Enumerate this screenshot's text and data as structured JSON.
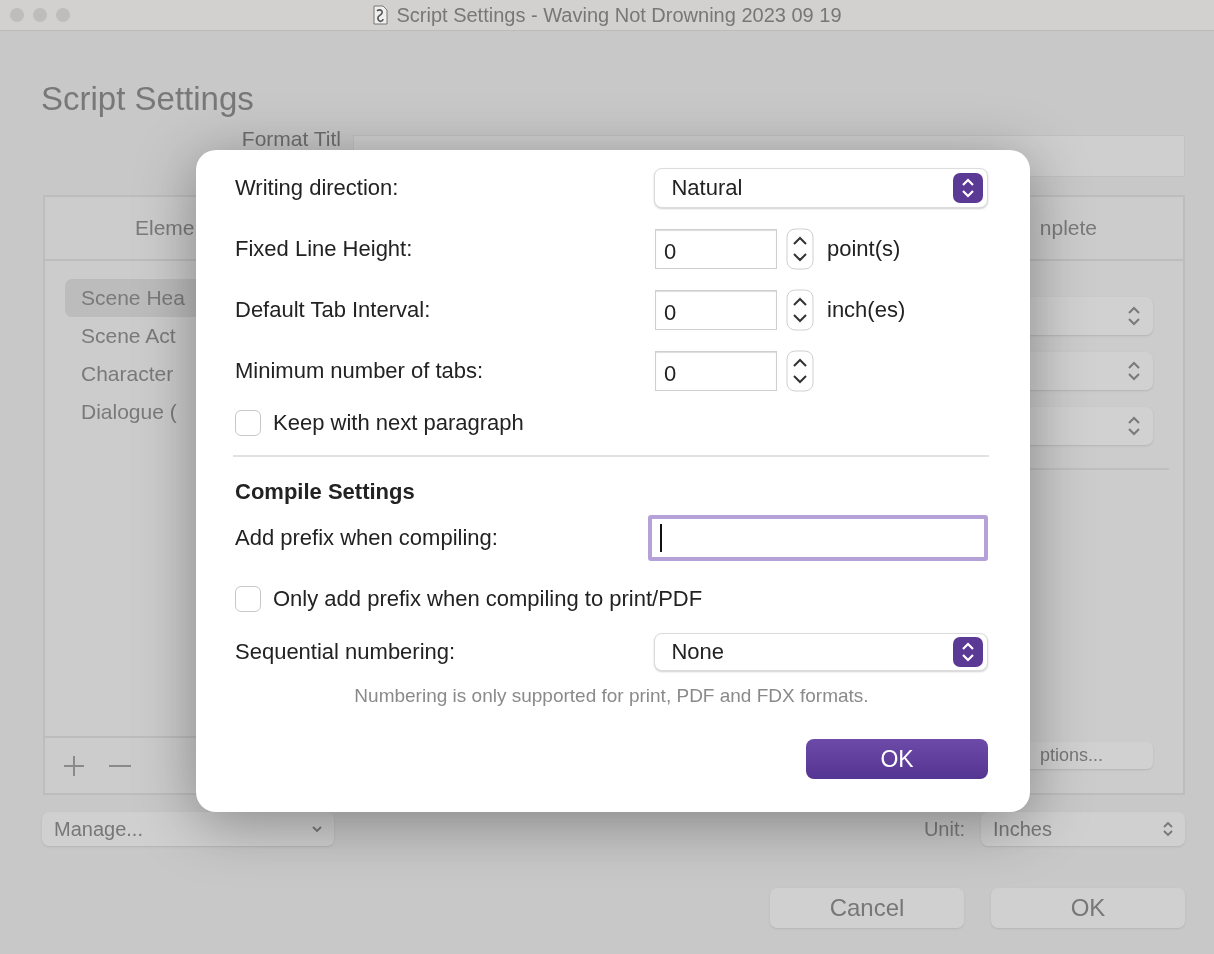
{
  "window": {
    "title": "Script Settings - Waving Not Drowning 2023 09 19"
  },
  "heading": "Script Settings",
  "format_title": {
    "label": "Format Titl"
  },
  "elements_panel": {
    "columns": [
      "Eleme",
      "nplete"
    ],
    "items": [
      {
        "label": "Scene Hea",
        "selected": true
      },
      {
        "label": "Scene Act",
        "selected": false
      },
      {
        "label": "Character",
        "selected": false
      },
      {
        "label": "Dialogue (",
        "selected": false
      }
    ],
    "options_button": "ptions..."
  },
  "manage": "Manage...",
  "unit": {
    "label": "Unit:",
    "value": "Inches"
  },
  "buttons": [
    {
      "label": "Cancel"
    },
    {
      "label": "OK"
    }
  ],
  "dialog": {
    "writing_direction": {
      "label": "Writing direction:",
      "value": "Natural"
    },
    "steppers": [
      {
        "label": "Fixed Line Height:",
        "value": "0",
        "unit": "point(s)"
      },
      {
        "label": "Default Tab Interval:",
        "value": "0",
        "unit": "inch(es)"
      },
      {
        "label": "Minimum number of tabs:",
        "value": "0"
      }
    ],
    "keep_with_next": {
      "label": "Keep with next paragraph",
      "checked": false
    },
    "section_title": "Compile Settings",
    "prefix": {
      "label": "Add prefix when compiling:",
      "focused": true
    },
    "print_only": {
      "label": "Only add prefix when compiling to print/PDF",
      "checked": false
    },
    "numbering": {
      "label": "Sequential numbering:",
      "value": "None"
    },
    "note": "Numbering is only supported for print, PDF and FDX formats.",
    "ok": "OK"
  }
}
